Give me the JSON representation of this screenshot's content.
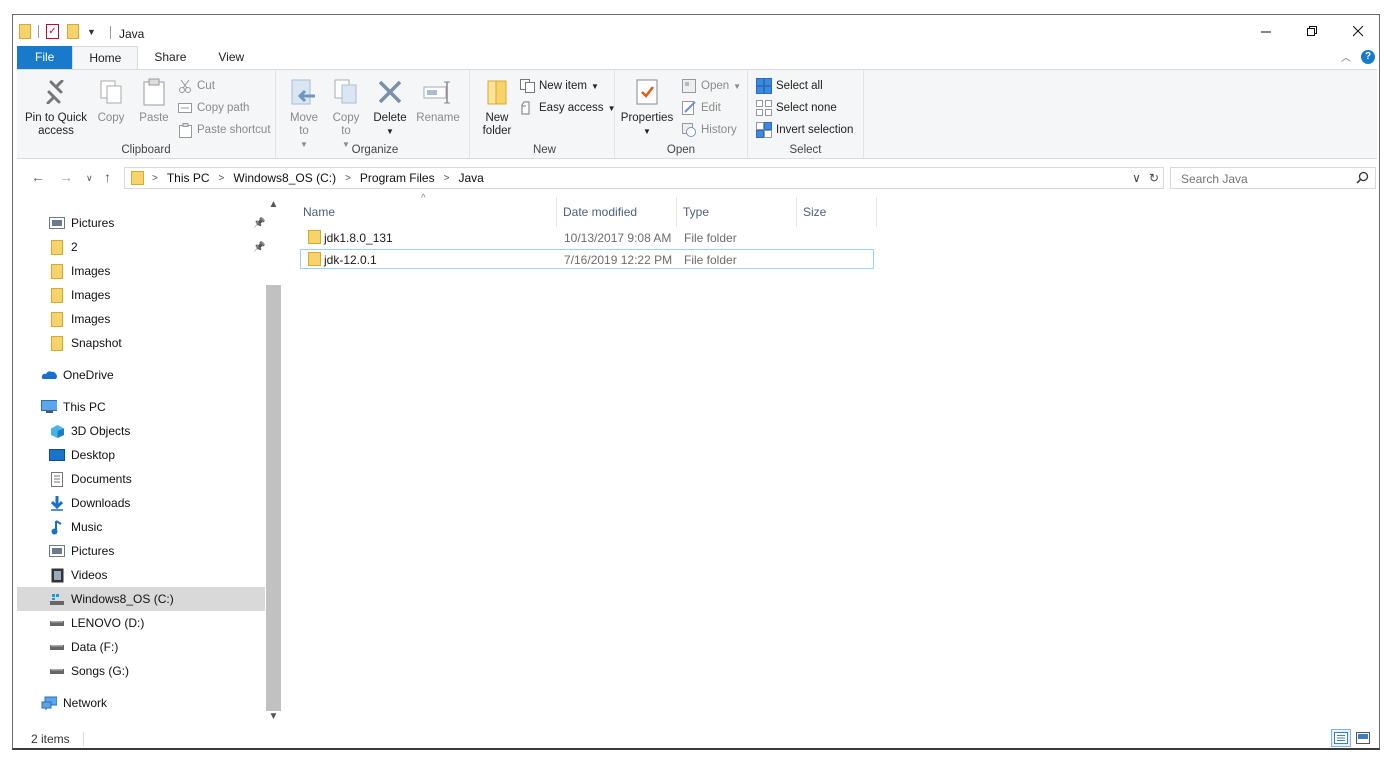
{
  "window": {
    "title": "Java"
  },
  "ribbon_tabs": [
    "File",
    "Home",
    "Share",
    "View"
  ],
  "ribbon": {
    "clipboard": {
      "label": "Clipboard",
      "pin_to_quick_access": "Pin to Quick access",
      "copy": "Copy",
      "paste": "Paste",
      "cut": "Cut",
      "copy_path": "Copy path",
      "paste_shortcut": "Paste shortcut"
    },
    "organize": {
      "label": "Organize",
      "move_to": "Move to",
      "copy_to": "Copy to",
      "delete": "Delete",
      "rename": "Rename"
    },
    "new": {
      "label": "New",
      "new_folder": "New folder",
      "new_item": "New item",
      "easy_access": "Easy access"
    },
    "open": {
      "label": "Open",
      "properties": "Properties",
      "open": "Open",
      "edit": "Edit",
      "history": "History"
    },
    "select": {
      "label": "Select",
      "select_all": "Select all",
      "select_none": "Select none",
      "invert_selection": "Invert selection"
    }
  },
  "address": {
    "crumbs": [
      "This PC",
      "Windows8_OS (C:)",
      "Program Files",
      "Java"
    ]
  },
  "search": {
    "placeholder": "Search Java"
  },
  "nav_pane": {
    "items": [
      {
        "label": "Pictures",
        "icon": "pictures-icon",
        "pinned": true
      },
      {
        "label": "2",
        "icon": "folder-icon",
        "pinned": true
      },
      {
        "label": "Images",
        "icon": "folder-icon"
      },
      {
        "label": "Images",
        "icon": "folder-icon"
      },
      {
        "label": "Images",
        "icon": "folder-icon"
      },
      {
        "label": "Snapshot",
        "icon": "folder-icon"
      },
      {
        "label": "OneDrive",
        "icon": "onedrive-icon"
      },
      {
        "label": "This PC",
        "icon": "this-pc-icon"
      },
      {
        "label": "3D Objects",
        "icon": "3d-objects-icon"
      },
      {
        "label": "Desktop",
        "icon": "desktop-icon"
      },
      {
        "label": "Documents",
        "icon": "documents-icon"
      },
      {
        "label": "Downloads",
        "icon": "downloads-icon"
      },
      {
        "label": "Music",
        "icon": "music-icon"
      },
      {
        "label": "Pictures",
        "icon": "pictures-icon"
      },
      {
        "label": "Videos",
        "icon": "videos-icon"
      },
      {
        "label": "Windows8_OS (C:)",
        "icon": "system-drive-icon",
        "selected": true
      },
      {
        "label": "LENOVO (D:)",
        "icon": "drive-icon"
      },
      {
        "label": "Data (F:)",
        "icon": "drive-icon"
      },
      {
        "label": "Songs (G:)",
        "icon": "drive-icon"
      },
      {
        "label": "Network",
        "icon": "network-icon"
      }
    ]
  },
  "file_list": {
    "columns": [
      "Name",
      "Date modified",
      "Type",
      "Size"
    ],
    "rows": [
      {
        "name": "jdk1.8.0_131",
        "date_modified": "10/13/2017 9:08 AM",
        "type": "File folder",
        "size": ""
      },
      {
        "name": "jdk-12.0.1",
        "date_modified": "7/16/2019 12:22 PM",
        "type": "File folder",
        "size": ""
      }
    ]
  },
  "status": {
    "item_count": "2 items"
  },
  "colors": {
    "accent": "#1979ca",
    "folder": "#f7d46b",
    "selection": "#d9d9d9",
    "row_focus_border": "#99d1ff"
  }
}
